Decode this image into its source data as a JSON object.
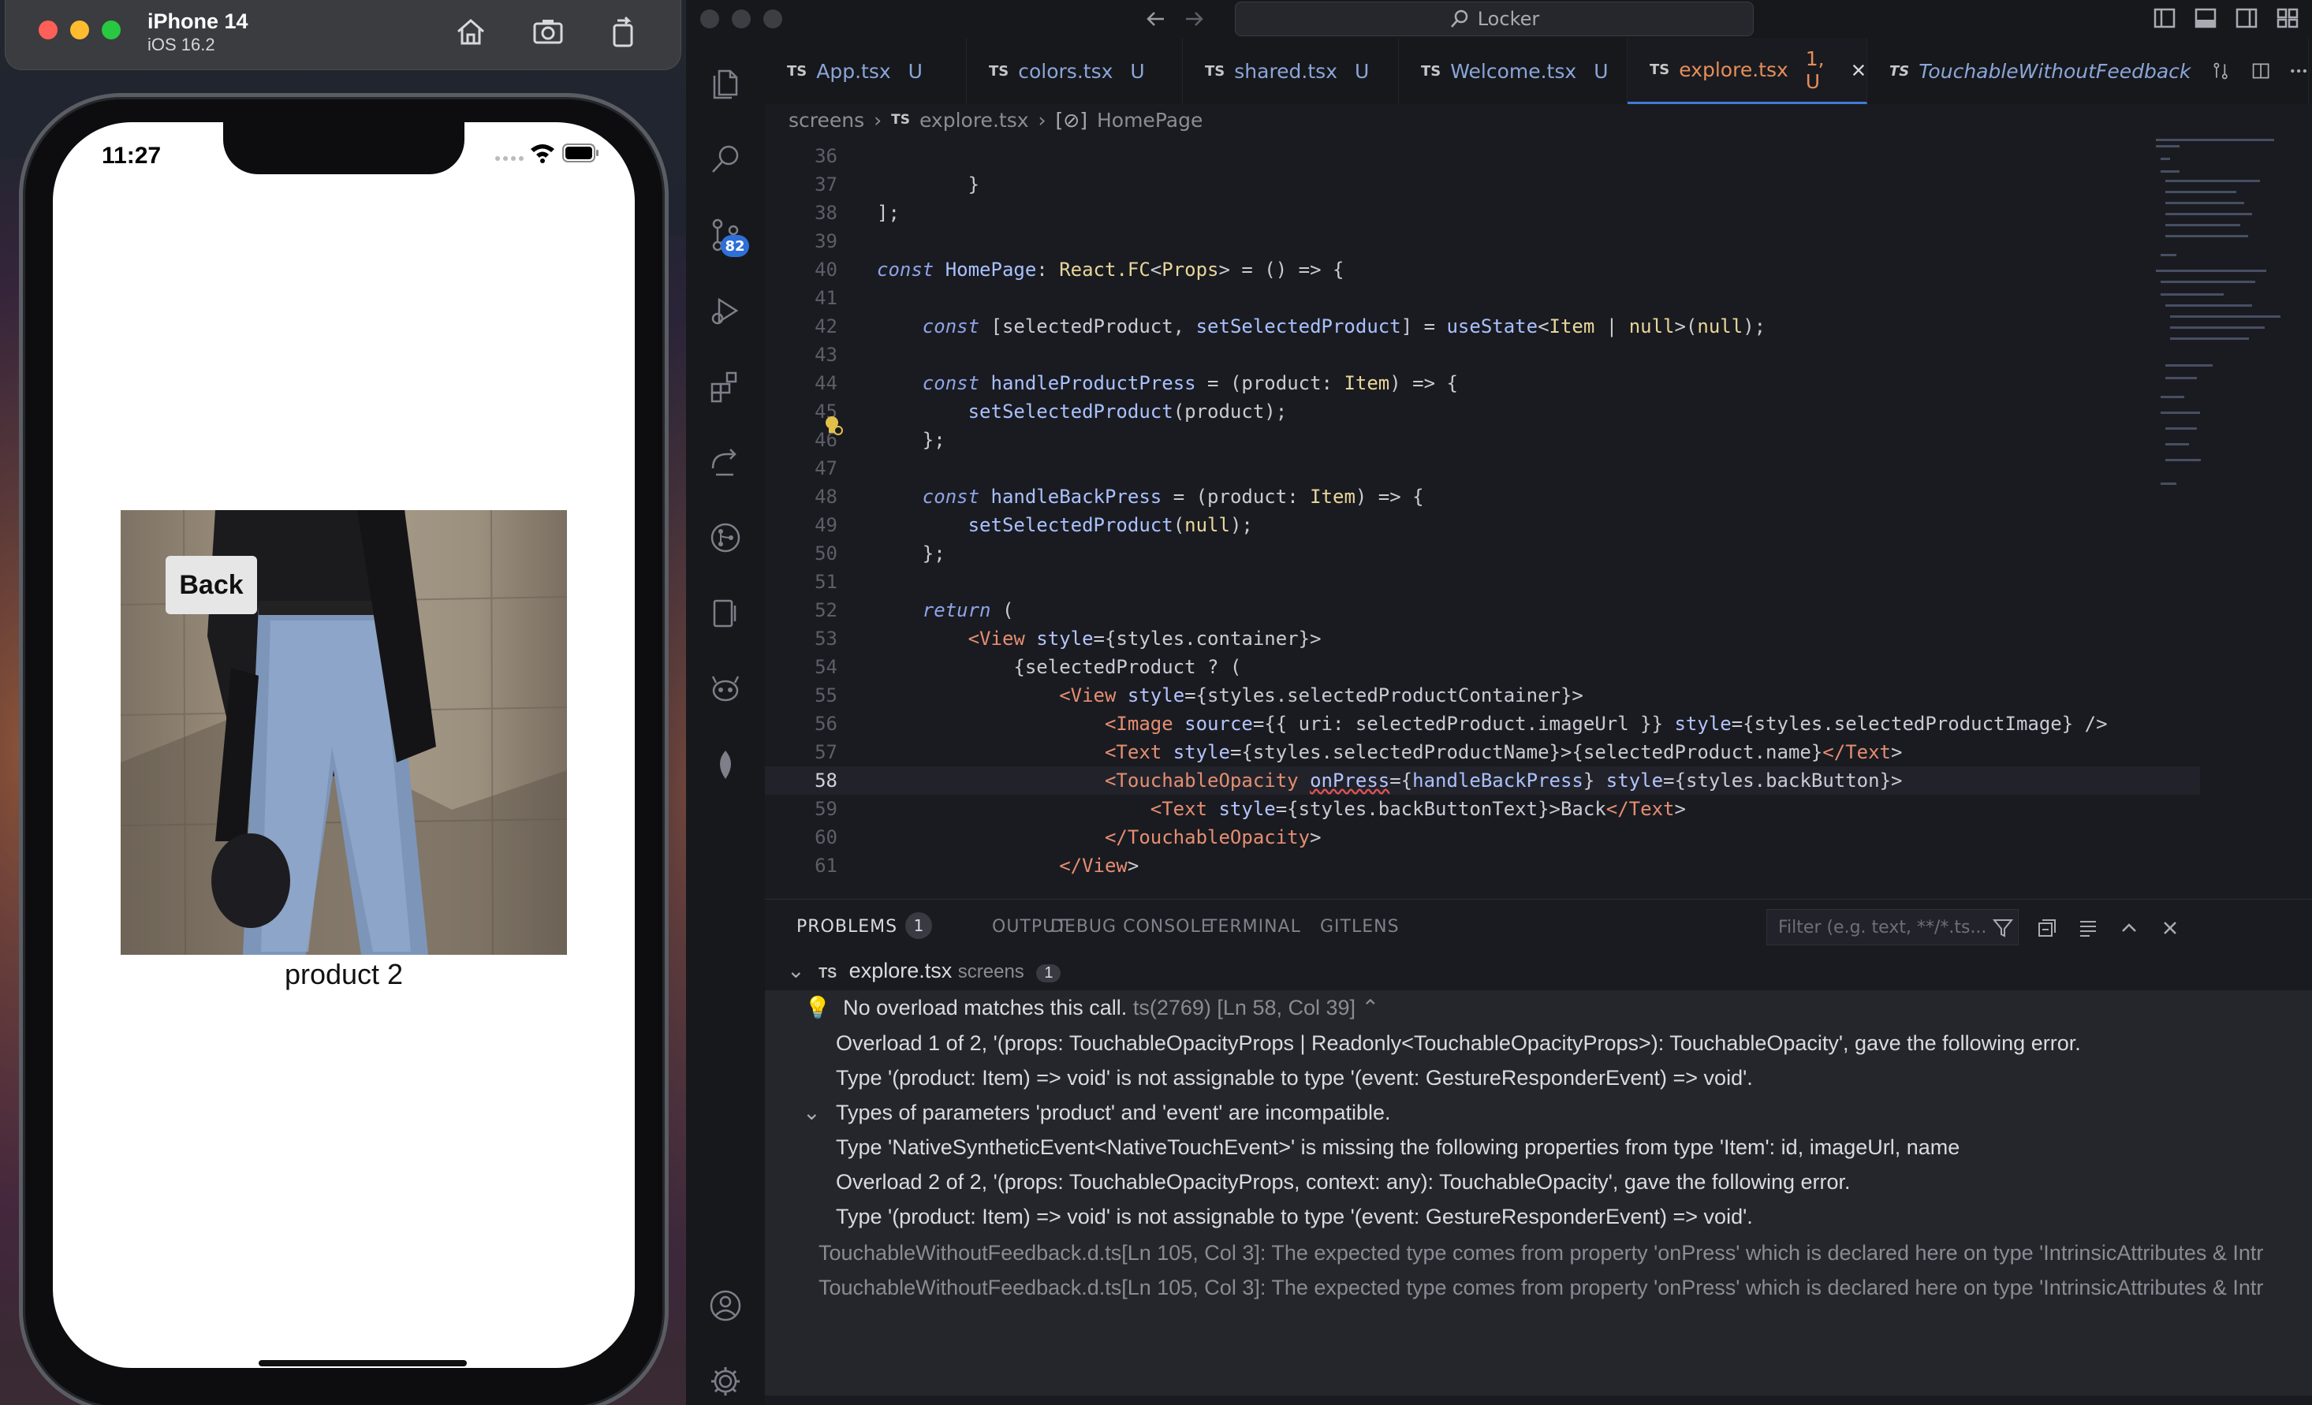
{
  "simulator": {
    "device_name": "iPhone 14",
    "os_version": "iOS 16.2",
    "status_time": "11:27",
    "back_label": "Back",
    "product_name": "product 2"
  },
  "vscode": {
    "command_center": "Locker",
    "tabs": [
      {
        "label": "App.tsx",
        "mod": "U"
      },
      {
        "label": "colors.tsx",
        "mod": "U"
      },
      {
        "label": "shared.tsx",
        "mod": "U"
      },
      {
        "label": "Welcome.tsx",
        "mod": "U"
      },
      {
        "label": "explore.tsx",
        "mod": "1, U"
      },
      {
        "label": "TouchableWithoutFeedback",
        "mod": ""
      }
    ],
    "ts_badge": "TS",
    "breadcrumb": [
      "screens",
      "explore.tsx",
      "HomePage"
    ],
    "scm_badge": "82",
    "editor": {
      "current_line": 58,
      "lines": [
        {
          "n": "36",
          "t": ""
        },
        {
          "n": "37",
          "t": "        }"
        },
        {
          "n": "38",
          "t": "];"
        },
        {
          "n": "39",
          "t": ""
        },
        {
          "n": "40",
          "t": "const HomePage: React.FC<Props> = () => {"
        },
        {
          "n": "41",
          "t": ""
        },
        {
          "n": "42",
          "t": "    const [selectedProduct, setSelectedProduct] = useState<Item | null>(null);"
        },
        {
          "n": "43",
          "t": ""
        },
        {
          "n": "44",
          "t": "    const handleProductPress = (product: Item) => {"
        },
        {
          "n": "45",
          "t": "        setSelectedProduct(product);"
        },
        {
          "n": "46",
          "t": "    };"
        },
        {
          "n": "47",
          "t": ""
        },
        {
          "n": "48",
          "t": "    const handleBackPress = (product: Item) => {"
        },
        {
          "n": "49",
          "t": "        setSelectedProduct(null);"
        },
        {
          "n": "50",
          "t": "    };"
        },
        {
          "n": "51",
          "t": ""
        },
        {
          "n": "52",
          "t": "    return ("
        },
        {
          "n": "53",
          "t": "        <View style={styles.container}>"
        },
        {
          "n": "54",
          "t": "            {selectedProduct ? ("
        },
        {
          "n": "55",
          "t": "                <View style={styles.selectedProductContainer}>"
        },
        {
          "n": "56",
          "t": "                    <Image source={{ uri: selectedProduct.imageUrl }} style={styles.selectedProductImage} />"
        },
        {
          "n": "57",
          "t": "                    <Text style={styles.selectedProductName}>{selectedProduct.name}</Text>"
        },
        {
          "n": "58",
          "t": "                    <TouchableOpacity onPress={handleBackPress} style={styles.backButton}>"
        },
        {
          "n": "59",
          "t": "                        <Text style={styles.backButtonText}>Back</Text>"
        },
        {
          "n": "60",
          "t": "                    </TouchableOpacity>"
        },
        {
          "n": "61",
          "t": "                </View>"
        }
      ]
    },
    "panel": {
      "tabs": [
        "PROBLEMS",
        "OUTPUT",
        "DEBUG CONSOLE",
        "TERMINAL",
        "GITLENS"
      ],
      "problem_count": "1",
      "filter_placeholder": "Filter (e.g. text, **/*.ts...",
      "file": "explore.tsx",
      "folder": "screens",
      "file_count": "1",
      "headline": "No overload matches this call.",
      "code": "ts(2769)",
      "location": "[Ln 58, Col 39]",
      "details": [
        "Overload 1 of 2, '(props: TouchableOpacityProps | Readonly<TouchableOpacityProps>): TouchableOpacity', gave the following error.",
        "Type '(product: Item) => void' is not assignable to type '(event: GestureResponderEvent) => void'.",
        "Types of parameters 'product' and 'event' are incompatible.",
        "Type 'NativeSyntheticEvent<NativeTouchEvent>' is missing the following properties from type 'Item': id, imageUrl, name",
        "Overload 2 of 2, '(props: TouchableOpacityProps, context: any): TouchableOpacity', gave the following error.",
        "Type '(product: Item) => void' is not assignable to type '(event: GestureResponderEvent) => void'."
      ],
      "related": [
        "TouchableWithoutFeedback.d.ts[Ln 105, Col 3]: The expected type comes from property 'onPress' which is declared here on type 'IntrinsicAttributes & Intr",
        "TouchableWithoutFeedback.d.ts[Ln 105, Col 3]: The expected type comes from property 'onPress' which is declared here on type 'IntrinsicAttributes & Intr"
      ]
    }
  }
}
